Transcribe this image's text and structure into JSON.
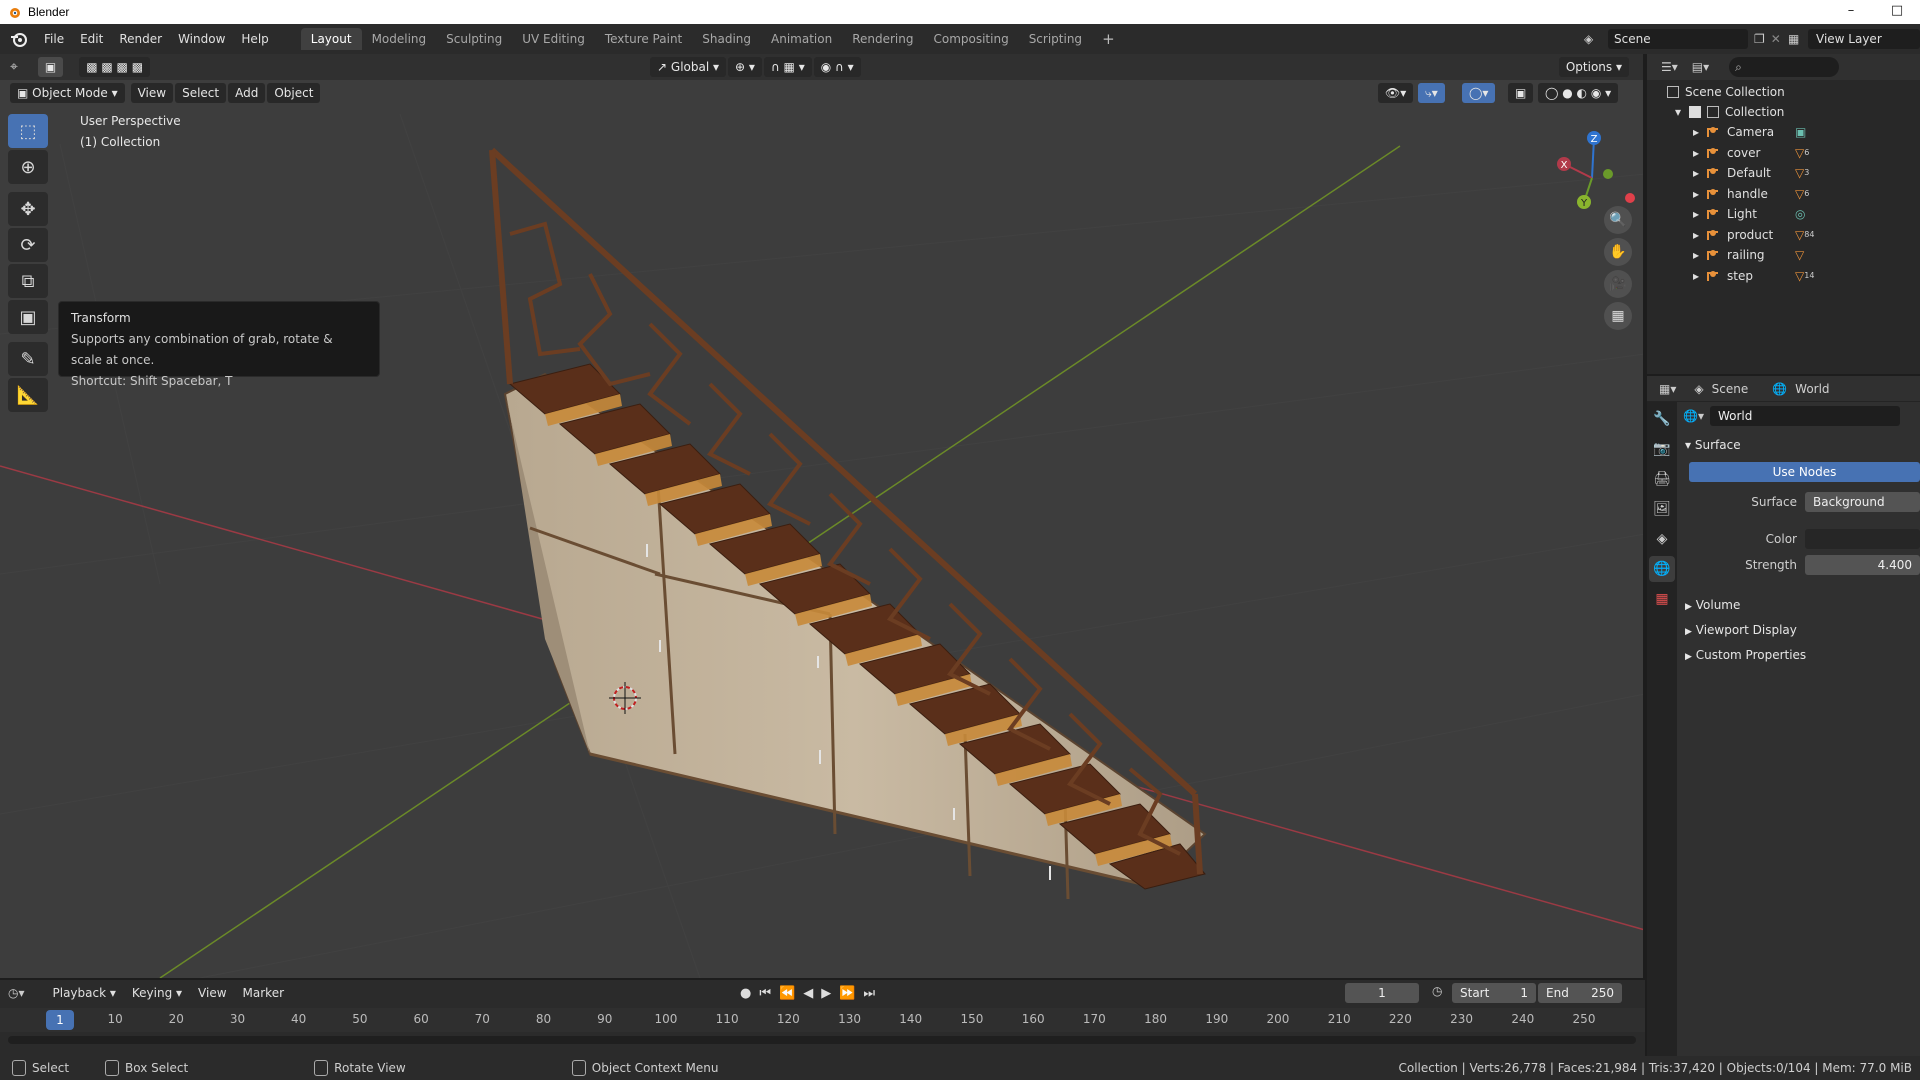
{
  "window": {
    "title": "Blender"
  },
  "menu": {
    "file": "File",
    "edit": "Edit",
    "render": "Render",
    "window": "Window",
    "help": "Help"
  },
  "workspaces": [
    "Layout",
    "Modeling",
    "Sculpting",
    "UV Editing",
    "Texture Paint",
    "Shading",
    "Animation",
    "Rendering",
    "Compositing",
    "Scripting"
  ],
  "scene": {
    "name": "Scene",
    "view_layer": "View Layer"
  },
  "viewport": {
    "transform_orientation": "Global",
    "options": "Options",
    "mode": "Object Mode",
    "view_menu": "View",
    "select_menu": "Select",
    "add_menu": "Add",
    "object_menu": "Object",
    "perspective": "User Perspective",
    "collection_label": "(1) Collection",
    "tooltip": {
      "title": "Transform",
      "desc": "Supports any combination of grab, rotate & scale at once.",
      "shortcut": "Shortcut: Shift Spacebar, T"
    },
    "gizmo": {
      "x": "X",
      "y": "Y",
      "z": "Z"
    }
  },
  "timeline": {
    "playback": "Playback",
    "keying": "Keying",
    "view": "View",
    "marker": "Marker",
    "current_frame": "1",
    "start_label": "Start",
    "start": "1",
    "end_label": "End",
    "end": "250",
    "ticks": [
      "10",
      "20",
      "30",
      "40",
      "50",
      "60",
      "70",
      "80",
      "90",
      "100",
      "110",
      "120",
      "130",
      "140",
      "150",
      "160",
      "170",
      "180",
      "190",
      "200",
      "210",
      "220",
      "230",
      "240",
      "250"
    ]
  },
  "statusbar": {
    "select": "Select",
    "box_select": "Box Select",
    "rotate_view": "Rotate View",
    "context_menu": "Object Context Menu",
    "stats": "Collection | Verts:26,778 | Faces:21,984 | Tris:37,420 | Objects:0/104 | Mem: 77.0 MiB"
  },
  "outliner": {
    "scene_collection": "Scene Collection",
    "collection": "Collection",
    "items": [
      {
        "name": "Camera",
        "icon": "camera-icon"
      },
      {
        "name": "cover",
        "icon": "mesh-icon"
      },
      {
        "name": "Default",
        "icon": "mesh-icon"
      },
      {
        "name": "handle",
        "icon": "mesh-icon"
      },
      {
        "name": "Light",
        "icon": "light-icon"
      },
      {
        "name": "product",
        "icon": "mesh-icon"
      },
      {
        "name": "railing",
        "icon": "mesh-icon"
      },
      {
        "name": "step",
        "icon": "mesh-icon"
      }
    ],
    "badges": [
      "6",
      "3",
      "6",
      "84",
      "14"
    ]
  },
  "properties": {
    "tab_scene": "Scene",
    "tab_world": "World",
    "world_name": "World",
    "surface_panel": "Surface",
    "use_nodes": "Use Nodes",
    "surface_label": "Surface",
    "surface_value": "Background",
    "color_label": "Color",
    "strength_label": "Strength",
    "strength_value": "4.400",
    "volume_panel": "Volume",
    "viewport_display_panel": "Viewport Display",
    "custom_properties_panel": "Custom Properties"
  },
  "colors": {
    "accent": "#4772b3",
    "axis_x": "#b13a4a",
    "axis_y": "#6a9a2a",
    "axis_z": "#2f74d0",
    "wood": "#6b3d22"
  }
}
